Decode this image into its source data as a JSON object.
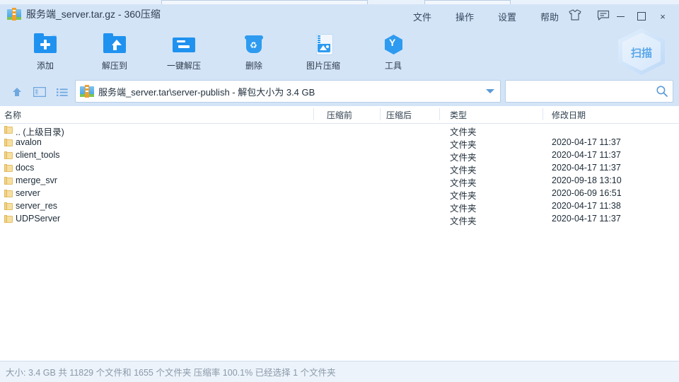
{
  "window": {
    "title": "服务端_server.tar.gz - 360压缩",
    "app_icon": "archive-icon"
  },
  "menu": {
    "items": [
      {
        "label": "文件",
        "name": "menu-file"
      },
      {
        "label": "操作",
        "name": "menu-action"
      },
      {
        "label": "设置",
        "name": "menu-settings"
      },
      {
        "label": "帮助",
        "name": "menu-help"
      }
    ],
    "skin_icon": "shirt-icon",
    "feedback_icon": "message-icon"
  },
  "window_controls": {
    "minimize": "minimize-icon",
    "maximize": "maximize-icon",
    "close": "×"
  },
  "toolbar": {
    "buttons": [
      {
        "label": "添加",
        "icon": "folder-add-icon"
      },
      {
        "label": "解压到",
        "icon": "folder-extract-to-icon"
      },
      {
        "label": "一键解压",
        "icon": "folder-quick-extract-icon"
      },
      {
        "label": "删除",
        "icon": "trash-icon"
      },
      {
        "label": "图片压缩",
        "icon": "image-compress-icon"
      },
      {
        "label": "工具",
        "icon": "tools-hex-icon"
      }
    ],
    "scan_button": {
      "label": "扫描",
      "icon": "hexagon-scan-icon"
    }
  },
  "navigation": {
    "up_icon": "up-arrow-icon",
    "view_icon": "view-panel-icon",
    "list_icon": "list-view-icon"
  },
  "address_bar": {
    "icon": "archive-icon",
    "path": "服务端_server.tar\\server-publish - 解包大小为 3.4 GB",
    "dropdown_icon": "chevron-down-icon"
  },
  "search": {
    "value": "",
    "placeholder": "",
    "icon": "search-icon"
  },
  "file_list": {
    "columns": [
      {
        "label": "名称",
        "key": "name"
      },
      {
        "label": "压缩前",
        "key": "size_before"
      },
      {
        "label": "压缩后",
        "key": "size_after"
      },
      {
        "label": "类型",
        "key": "type"
      },
      {
        "label": "修改日期",
        "key": "modified"
      }
    ],
    "rows": [
      {
        "name": ".. (上级目录)",
        "size_before": "",
        "size_after": "",
        "type": "文件夹",
        "modified": ""
      },
      {
        "name": "avalon",
        "size_before": "",
        "size_after": "",
        "type": "文件夹",
        "modified": "2020-04-17 11:37"
      },
      {
        "name": "client_tools",
        "size_before": "",
        "size_after": "",
        "type": "文件夹",
        "modified": "2020-04-17 11:37"
      },
      {
        "name": "docs",
        "size_before": "",
        "size_after": "",
        "type": "文件夹",
        "modified": "2020-04-17 11:37"
      },
      {
        "name": "merge_svr",
        "size_before": "",
        "size_after": "",
        "type": "文件夹",
        "modified": "2020-09-18 13:10"
      },
      {
        "name": "server",
        "size_before": "",
        "size_after": "",
        "type": "文件夹",
        "modified": "2020-06-09 16:51"
      },
      {
        "name": "server_res",
        "size_before": "",
        "size_after": "",
        "type": "文件夹",
        "modified": "2020-04-17 11:38"
      },
      {
        "name": "UDPServer",
        "size_before": "",
        "size_after": "",
        "type": "文件夹",
        "modified": "2020-04-17 11:37"
      }
    ]
  },
  "status_bar": {
    "text": "大小: 3.4 GB 共 11829 个文件和 1655 个文件夹 压缩率 100.1% 已经选择 1 个文件夹"
  },
  "colors": {
    "chrome": "#d4e4f7",
    "accent": "#2e9bf0",
    "status_text": "#8a99a8"
  }
}
